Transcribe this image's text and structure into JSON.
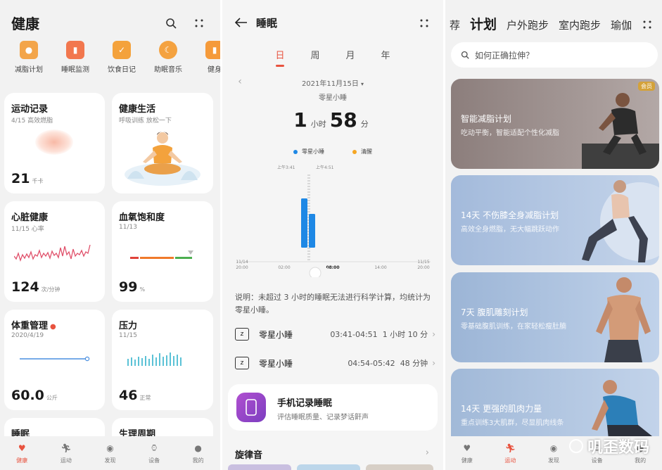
{
  "screen1": {
    "title": "健康",
    "shortcuts": [
      {
        "label": "减脂计划",
        "color": "#f0a040"
      },
      {
        "label": "睡眠监测",
        "color": "#f07a50"
      },
      {
        "label": "饮食日记",
        "color": "#f5a03a"
      },
      {
        "label": "助眠音乐",
        "color": "#f4a040"
      },
      {
        "label": "健身",
        "color": "#f59a3a"
      }
    ],
    "cards": {
      "exercise": {
        "title": "运动记录",
        "sub": "4/15 高效燃脂",
        "value": "21",
        "unit": "千卡"
      },
      "life": {
        "title": "健康生活",
        "sub": "呼吸训练 放松一下"
      },
      "heart": {
        "title": "心脏健康",
        "sub": "11/15 心率",
        "value": "124",
        "unit": "次/分钟"
      },
      "spo2": {
        "title": "血氧饱和度",
        "sub": "11/13",
        "value": "99",
        "unit": "%"
      },
      "weight": {
        "title": "体重管理",
        "sub": "2020/4/19",
        "value": "60.0",
        "unit": "公斤"
      },
      "stress": {
        "title": "压力",
        "sub": "11/15",
        "value": "46",
        "unit": "正常"
      },
      "sleep": {
        "title": "睡眠"
      },
      "cycle": {
        "title": "生理周期"
      }
    },
    "tabs": [
      "健康",
      "运动",
      "发现",
      "设备",
      "我的"
    ]
  },
  "screen2": {
    "title": "睡眠",
    "periods": [
      "日",
      "周",
      "月",
      "年"
    ],
    "date": "2021年11月15日",
    "sleep_type": "零星小睡",
    "duration": {
      "hours": "1",
      "hours_unit": "小时",
      "minutes": "58",
      "minutes_unit": "分"
    },
    "legend": [
      {
        "label": "零星小睡",
        "color": "#1e88e5"
      },
      {
        "label": "清醒",
        "color": "#f5a623"
      }
    ],
    "chart": {
      "marker_left": "上午3:41",
      "marker_right": "上午4:51",
      "ticks": [
        {
          "line1": "11/14",
          "line2": "20:00"
        },
        {
          "line1": "",
          "line2": "02:00"
        },
        {
          "line1": "",
          "line2": "08:00"
        },
        {
          "line1": "",
          "line2": "14:00"
        },
        {
          "line1": "11/15",
          "line2": "20:00"
        }
      ]
    },
    "chart_data": {
      "type": "bar",
      "categories": [
        "03:41-04:51",
        "04:54-05:42"
      ],
      "values": [
        70,
        48
      ],
      "title": "",
      "xlabel": "",
      "ylabel": ""
    },
    "note": "说明：未超过 3 小时的睡眠无法进行科学计算，均统计为零星小睡。",
    "rows": [
      {
        "name": "零星小睡",
        "time": "03:41-04:51",
        "length": "1 小时 10 分"
      },
      {
        "name": "零星小睡",
        "time": "04:54-05:42",
        "length": "48 分钟"
      }
    ],
    "phone_card": {
      "title": "手机记录睡眠",
      "sub": "评估睡眠质量、记录梦话鼾声"
    },
    "melody": "旋律音"
  },
  "screen3": {
    "tabs": [
      "荐",
      "计划",
      "户外跑步",
      "室内跑步",
      "瑜伽"
    ],
    "search_placeholder": "如何正确拉伸？",
    "plans": [
      {
        "title": "智能减脂计划",
        "sub": "吃动平衡，智能适配个性化减脂",
        "badge": "会员",
        "bg": "#8f7f7d"
      },
      {
        "title": "14天 不伤膝全身减脂计划",
        "sub": "高效全身燃脂，无大幅跳跃动作",
        "badge": "",
        "bg": "#a6bdd9"
      },
      {
        "title": "7天 腹肌雕刻计划",
        "sub": "零基础腹肌训练，在家轻松瘦肚腩",
        "badge": "",
        "bg": "#9fb8d8"
      },
      {
        "title": "14天 更强的肌肉力量",
        "sub": "重点训练3大肌群，尽显肌肉线条",
        "badge": "",
        "bg": "#a4bcd9"
      }
    ],
    "tabs_bottom": [
      "健康",
      "运动",
      "发现",
      "设备",
      "我的"
    ],
    "watermark": "叽歪数码"
  },
  "colors": {
    "accent": "#e8533f",
    "blue": "#1e88e5"
  }
}
